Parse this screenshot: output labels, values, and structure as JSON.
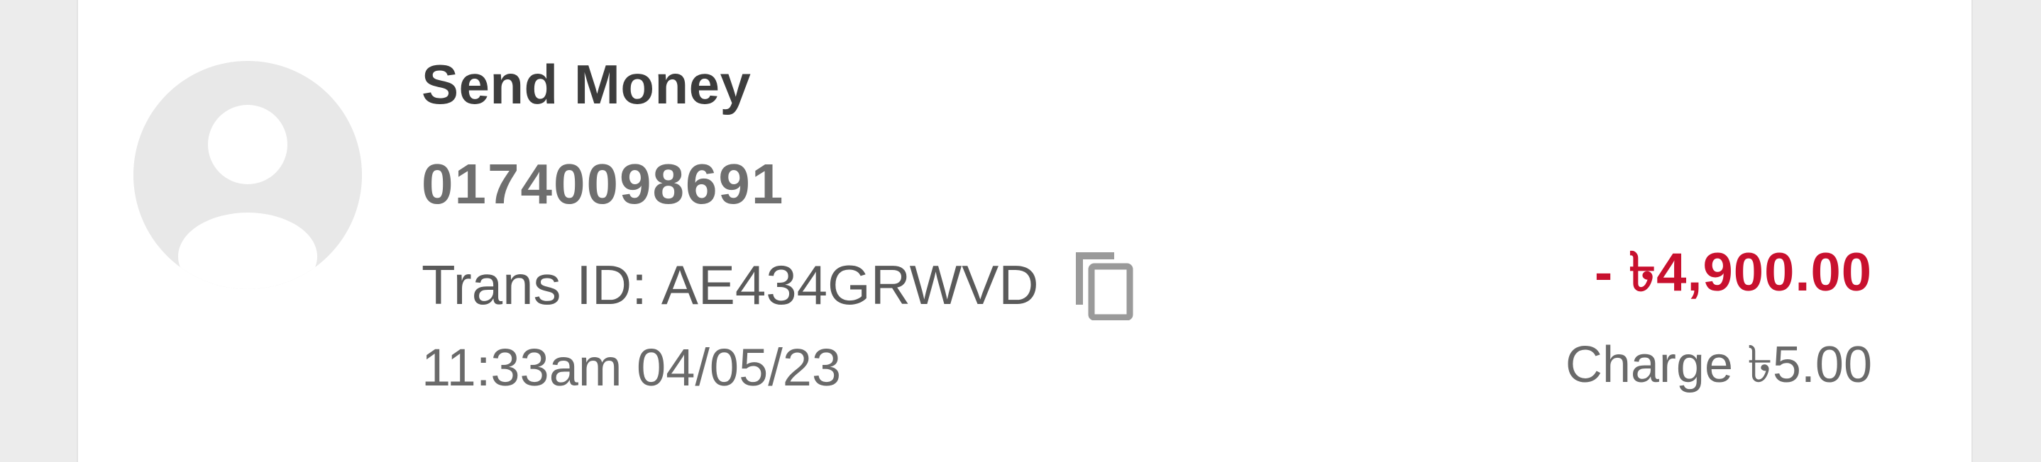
{
  "transaction": {
    "type": "Send Money",
    "phone": "01740098691",
    "trans_id_label": "Trans ID:",
    "trans_id": "AE434GRWVD",
    "datetime": "11:33am 04/05/23",
    "amount": "- ৳4,900.00",
    "charge": "Charge ৳5.00"
  },
  "icons": {
    "avatar": "user-avatar-icon",
    "copy": "copy-icon"
  },
  "colors": {
    "amount": "#c8102e",
    "avatar_bg": "#e8e8e8",
    "avatar_fg": "#ffffff"
  }
}
